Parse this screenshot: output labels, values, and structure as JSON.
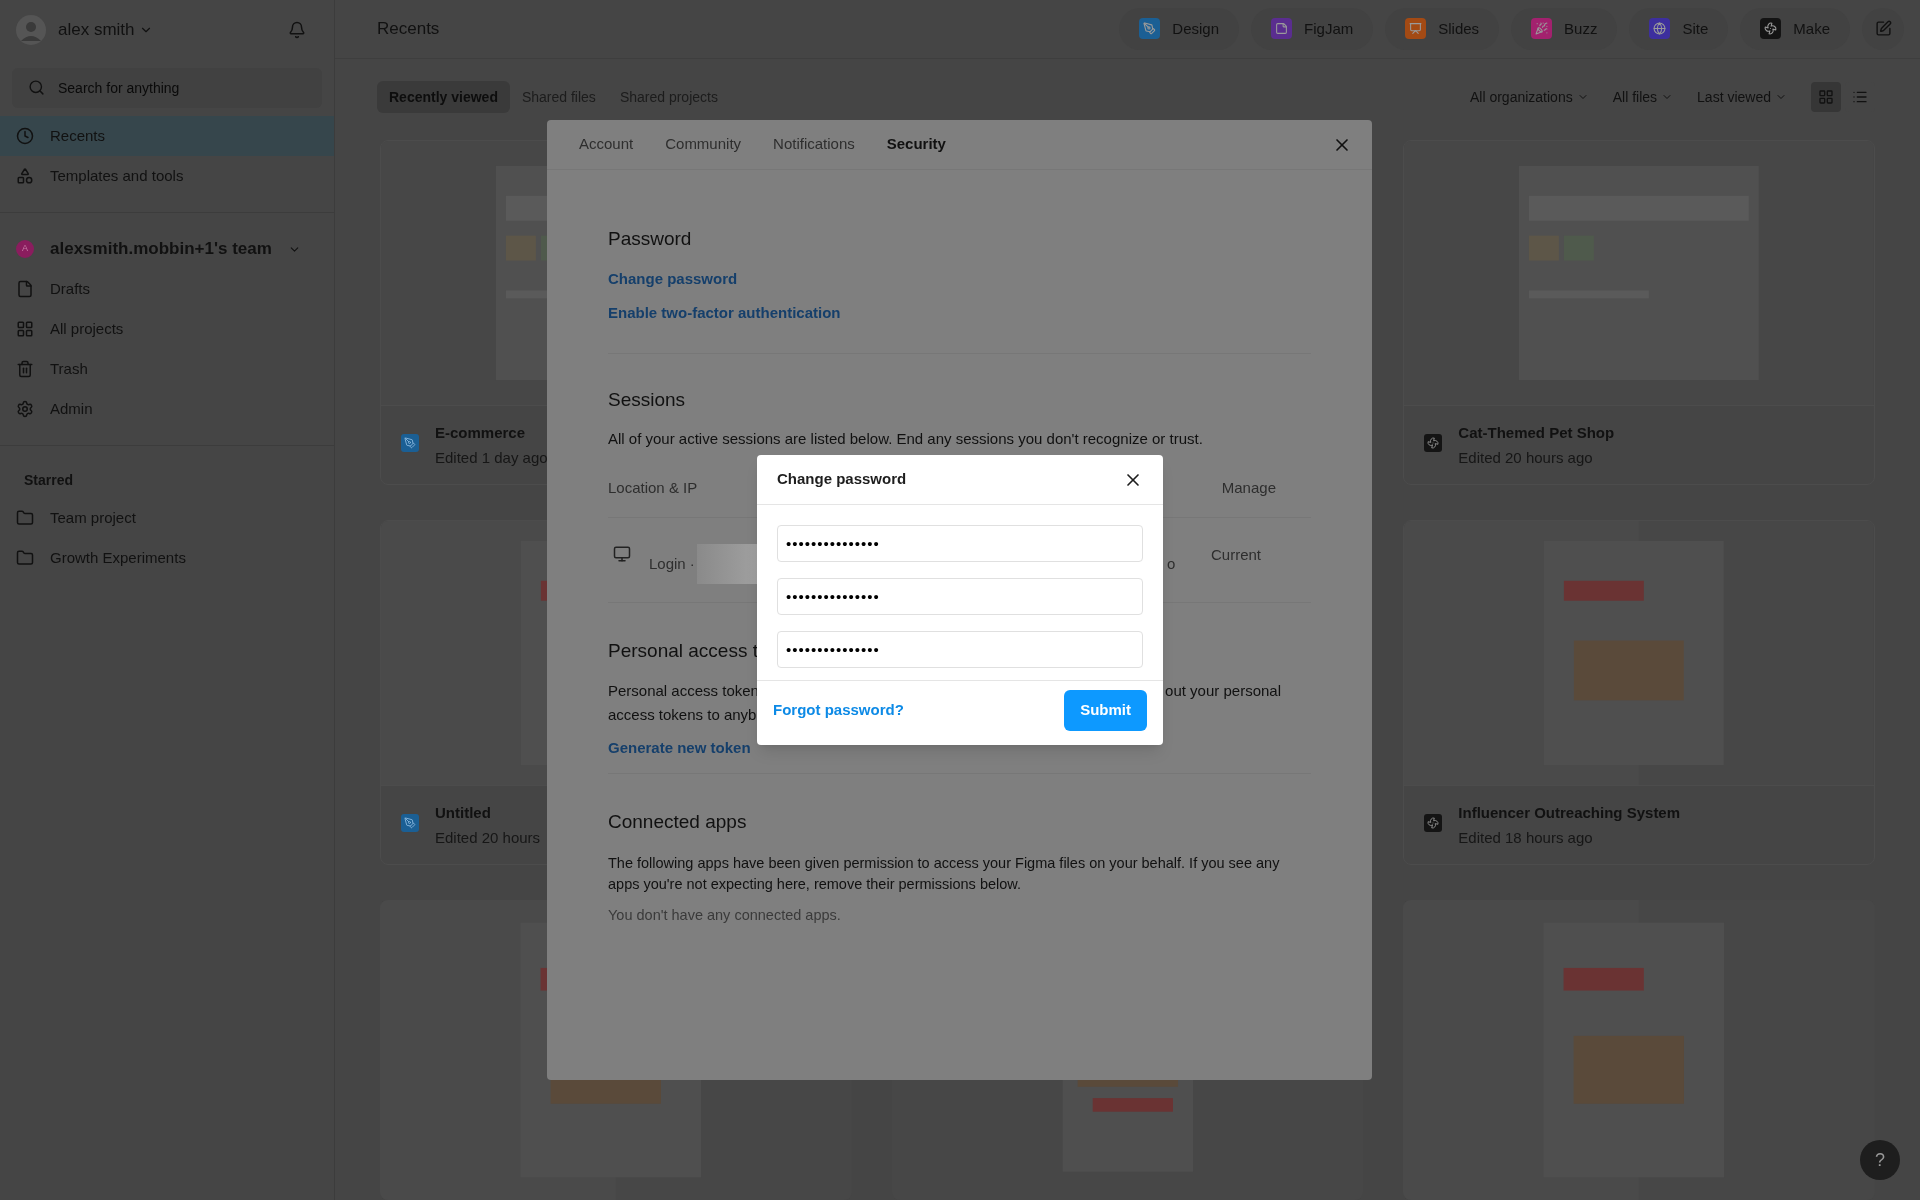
{
  "user": {
    "name": "alex smith"
  },
  "search": {
    "placeholder": "Search for anything"
  },
  "nav": [
    {
      "label": "Recents",
      "selected": true
    },
    {
      "label": "Templates and tools",
      "selected": false
    }
  ],
  "team": {
    "initial": "A",
    "name": "alexsmith.mobbin+1's team",
    "color": "#8a1d5e"
  },
  "team_items": [
    {
      "label": "Drafts"
    },
    {
      "label": "All projects"
    },
    {
      "label": "Trash"
    },
    {
      "label": "Admin"
    }
  ],
  "starred": {
    "title": "Starred",
    "items": [
      {
        "label": "Team project"
      },
      {
        "label": "Growth Experiments"
      }
    ]
  },
  "header": {
    "title": "Recents"
  },
  "apps": [
    {
      "label": "Design",
      "color": "#1b5f94"
    },
    {
      "label": "FigJam",
      "color": "#5a2d8f"
    },
    {
      "label": "Slides",
      "color": "#a34a14"
    },
    {
      "label": "Buzz",
      "color": "#a3216e"
    },
    {
      "label": "Site",
      "color": "#3d2f9e"
    },
    {
      "label": "Make",
      "color": "#141414"
    }
  ],
  "view_tabs": [
    {
      "label": "Recently viewed",
      "selected": true
    },
    {
      "label": "Shared files",
      "selected": false
    },
    {
      "label": "Shared projects",
      "selected": false
    }
  ],
  "filters": [
    "All organizations",
    "All files",
    "Last viewed"
  ],
  "view_modes": [
    {
      "kind": "grid",
      "selected": true
    },
    {
      "kind": "list",
      "selected": false
    }
  ],
  "file_columns": [
    [
      {
        "title": "E-commerce",
        "edited": "Edited 1 day ago",
        "kind": "design"
      },
      {
        "title": "Untitled",
        "edited": "Edited 20 hours",
        "kind": "design"
      },
      {
        "kind": "picture"
      }
    ],
    [
      {
        "kind": "picture"
      }
    ],
    [
      {
        "title": "Cat-Themed Pet Shop",
        "edited": "Edited 20 hours ago",
        "kind": "make"
      },
      {
        "title": "Influencer Outreaching System",
        "edited": "Edited 18 hours ago",
        "kind": "make"
      },
      {
        "kind": "picture"
      }
    ]
  ],
  "settings": {
    "tabs": [
      {
        "label": "Account",
        "selected": false
      },
      {
        "label": "Community",
        "selected": false
      },
      {
        "label": "Notifications",
        "selected": false
      },
      {
        "label": "Security",
        "selected": true
      }
    ],
    "password": {
      "title": "Password",
      "links": [
        "Change password",
        "Enable two-factor authentication"
      ]
    },
    "sessions": {
      "title": "Sessions",
      "description": "All of your active sessions are listed below. End any sessions you don't recognize or trust.",
      "columns": [
        "Location & IP",
        "Manage"
      ],
      "row": {
        "login": "Login ·",
        "column_3": "o",
        "manage": "Current"
      }
    },
    "tokens": {
      "title": "Personal access t",
      "line_1_left": "Personal access token",
      "line_1_right": "out your personal",
      "line_2_left": "access tokens to anyb",
      "link": "Generate new token"
    },
    "apps": {
      "title": "Connected apps",
      "description": "The following apps have been given permission to access your Figma files on your behalf. If you see any apps you're not expecting here, remove their permissions below.",
      "empty": "You don't have any connected apps."
    }
  },
  "dialog": {
    "title": "Change password",
    "fields": [
      {
        "value": "•••••••••••••••"
      },
      {
        "value": "•••••••••••••••"
      },
      {
        "value": "•••••••••••••••"
      }
    ],
    "forgot": "Forgot password?",
    "submit": "Submit"
  },
  "help": {
    "label": "?"
  }
}
